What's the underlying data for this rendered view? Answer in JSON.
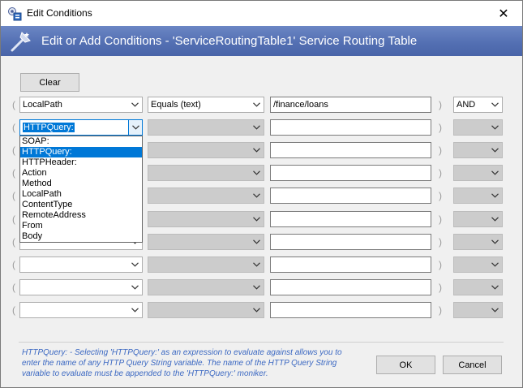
{
  "window": {
    "title": "Edit Conditions",
    "close_glyph": "✕"
  },
  "banner": {
    "text": "Edit or Add Conditions - 'ServiceRoutingTable1' Service Routing Table"
  },
  "toolbar": {
    "clear_label": "Clear"
  },
  "paren_open": "(",
  "paren_close": ")",
  "rows": [
    {
      "field": "LocalPath",
      "operator": "Equals (text)",
      "value": "/finance/loans",
      "logic": "AND"
    },
    {
      "field": "HTTPQuery:",
      "operator": "",
      "value": "",
      "logic": ""
    },
    {
      "field": "",
      "operator": "",
      "value": "",
      "logic": ""
    },
    {
      "field": "",
      "operator": "",
      "value": "",
      "logic": ""
    },
    {
      "field": "",
      "operator": "",
      "value": "",
      "logic": ""
    },
    {
      "field": "",
      "operator": "",
      "value": "",
      "logic": ""
    },
    {
      "field": "",
      "operator": "",
      "value": "",
      "logic": ""
    },
    {
      "field": "",
      "operator": "",
      "value": "",
      "logic": ""
    },
    {
      "field": "",
      "operator": "",
      "value": "",
      "logic": ""
    },
    {
      "field": "",
      "operator": "",
      "value": "",
      "logic": ""
    }
  ],
  "dropdown": {
    "options": [
      "SOAP:",
      "HTTPQuery:",
      "HTTPHeader:",
      "Action",
      "Method",
      "LocalPath",
      "ContentType",
      "RemoteAddress",
      "From",
      "Body"
    ],
    "selected": "HTTPQuery:"
  },
  "help": {
    "text": "HTTPQuery: - Selecting 'HTTPQuery:' as an expression to evaluate against allows you to enter the name of any HTTP Query String variable. The name of the HTTP Query String variable to evaluate must be appended to the 'HTTPQuery:' moniker."
  },
  "footer": {
    "ok_label": "OK",
    "cancel_label": "Cancel"
  },
  "icons": {
    "app": "app-icon",
    "banner": "wizard-wand-icon",
    "dropdown_arrow": "chevron-down-icon"
  }
}
